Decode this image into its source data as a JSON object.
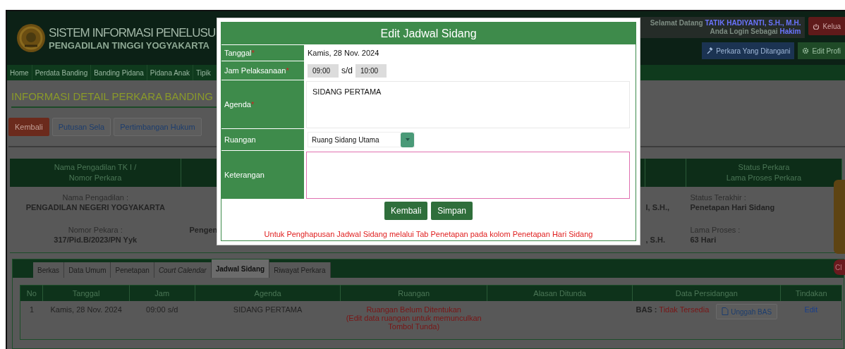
{
  "header": {
    "title": "SISTEM INFORMASI PENELUSU",
    "subtitle": "PENGADILAN TINGGI YOGYAKARTA",
    "welcome": "Selamat Datang",
    "user_name": "TATIK HADIYANTI, S.H., M.H.",
    "login_as": "Anda Login Sebagai",
    "role": "Hakim",
    "buttons": [
      {
        "label": "Kelua",
        "kind": "logout"
      },
      {
        "label": "Perkara Yang Ditangani",
        "kind": "cases"
      },
      {
        "label": "Edit Profi",
        "kind": "profile"
      }
    ]
  },
  "nav": {
    "items": [
      {
        "label": "Home"
      },
      {
        "label": "Perdata Banding"
      },
      {
        "label": "Banding Pidana"
      },
      {
        "label": "Pidana Anak"
      },
      {
        "label": "Tipik"
      }
    ]
  },
  "page_title": "INFORMASI DETAIL PERKARA BANDING",
  "action_buttons": [
    {
      "label": "Kembali",
      "kind": "danger"
    },
    {
      "label": "Putusan Sela",
      "kind": "default"
    },
    {
      "label": "Pertimbangan Hukum",
      "kind": "default"
    }
  ],
  "detail_table": {
    "column_1_header": [
      "Nama Pengadilan TK I /",
      "Nomor Perkara"
    ],
    "column_4_header": [
      "Status Perkara",
      "Lama Proses Perkara"
    ],
    "court_label": "Nama Pengadilan :",
    "court_name": "PENGADILAN NEGERI YOGYAKARTA",
    "case_number_label": "Nomor Pekara :",
    "case_number": "317/Pid.B/2023/PN Yyk",
    "column_2_text": "Pengen",
    "column_3_texts": [
      "I, S.H.,",
      ", S.H."
    ],
    "status_label": "Status Terakhir :",
    "status": "Penetapan Hari Sidang",
    "duration_label": "Lama Proses :",
    "duration": "63 Hari"
  },
  "side_widget": {
    "label": "Cl"
  },
  "case_tabs": {
    "tabs": [
      {
        "label": "Berkas",
        "selected": false,
        "italic": false
      },
      {
        "label": "Data Umum",
        "selected": false,
        "italic": false
      },
      {
        "label": "Penetapan",
        "selected": false,
        "italic": false
      },
      {
        "label": "Court Calendar",
        "selected": false,
        "italic": true
      },
      {
        "label": "Jadwal Sidang",
        "selected": true,
        "italic": false
      },
      {
        "label": "Riwayat Perkara",
        "selected": false,
        "italic": false
      }
    ],
    "table": {
      "columns": [
        "No",
        "Tanggal",
        "Jam",
        "Agenda",
        "Ruangan",
        "Alasan Ditunda",
        "Data Persidangan",
        "Tindakan"
      ],
      "rows": [
        {
          "no": "1",
          "date": "Kamis, 28 Nov. 2024",
          "time": "09:00 s/d",
          "agenda": "SIDANG PERTAMA",
          "room_lines": [
            "Ruangan Belum Ditentukan",
            "(Edit data ruangan untuk memunculkan",
            "Tombol Tunda)"
          ],
          "bas_label": "BAS :",
          "bas_status": "Tidak Tersedia",
          "upload_button": "Unggah BAS",
          "action_link": "Edit"
        }
      ]
    }
  },
  "modal": {
    "title": "Edit Jadwal Sidang",
    "fields": [
      {
        "kind": "text",
        "label": "Tanggal",
        "required_mark": "*",
        "value": "Kamis, 28 Nov. 2024"
      },
      {
        "kind": "time_range",
        "label": "Jam Pelaksanaan",
        "required_mark": "*",
        "start": "09:00",
        "separator": "s/d",
        "end": "10:00"
      },
      {
        "kind": "textarea",
        "label": "Agenda",
        "required_mark": "*",
        "value": "SIDANG PERTAMA",
        "focused": false
      },
      {
        "kind": "select",
        "label": "Ruangan",
        "value": "Ruang Sidang Utama"
      },
      {
        "kind": "textarea",
        "label": "Keterangan",
        "focused": true
      }
    ],
    "buttons": [
      {
        "label": "Kembali"
      },
      {
        "label": "Simpan"
      }
    ],
    "note": "Untuk Penghapusan Jadwal Sidang melalui Tab Penetapan pada kolom Penetapan Hari Sidang"
  }
}
